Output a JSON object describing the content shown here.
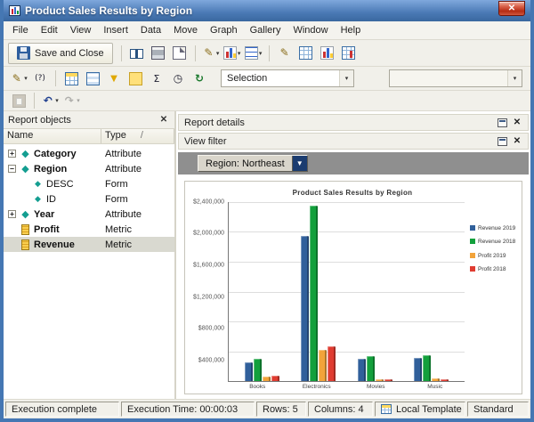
{
  "window": {
    "title": "Product Sales Results by Region"
  },
  "menu_bar": {
    "items": [
      "File",
      "Edit",
      "View",
      "Insert",
      "Data",
      "Move",
      "Graph",
      "Gallery",
      "Window",
      "Help"
    ]
  },
  "icons": {
    "close": "✕",
    "dropdown_arrow": "▼",
    "dropdown_small": "▾",
    "undo": "↶",
    "redo": "↷",
    "clock": "◷",
    "sigma": "Σ",
    "autotext": "(?)",
    "refresh": "↻",
    "pencil": "✎",
    "funnel": "▼",
    "diamond": "◆",
    "expand": "+",
    "collapse": "−"
  },
  "toolbars": {
    "save_and_close_label": "Save and Close",
    "selection_combo_value": "Selection",
    "secondary_combo_value": "",
    "row1_icon_groups": [
      [
        "book",
        "printer",
        "page-setup"
      ],
      [
        "format-painter-dd",
        "graph-format-dd",
        "autostyle-dd"
      ],
      [
        "design-view",
        "grid-view",
        "graph-view",
        "grid-graph-view"
      ]
    ],
    "row2_icon_groups": [
      [
        "format-brush-dd",
        "autotext"
      ],
      [
        "grid-color",
        "banding",
        "view-filter",
        "note",
        "totals",
        "clock",
        "refresh"
      ]
    ],
    "row3_icon_groups": [
      [
        "paste"
      ],
      [
        "undo-dd",
        "redo-dd"
      ]
    ],
    "disabled_icons": [
      "paste",
      "redo-dd"
    ]
  },
  "report_objects": {
    "title": "Report objects",
    "columns": [
      "Name",
      "Type"
    ],
    "type_header_suffix": "/",
    "rows": [
      {
        "name": "Category",
        "type": "Attribute",
        "level": 0,
        "expander": "+",
        "icon": "attribute",
        "selected": false
      },
      {
        "name": "Region",
        "type": "Attribute",
        "level": 0,
        "expander": "-",
        "icon": "attribute",
        "selected": false
      },
      {
        "name": "DESC",
        "type": "Form",
        "level": 1,
        "expander": "",
        "icon": "form",
        "selected": false
      },
      {
        "name": "ID",
        "type": "Form",
        "level": 1,
        "expander": "",
        "icon": "form",
        "selected": false
      },
      {
        "name": "Year",
        "type": "Attribute",
        "level": 0,
        "expander": "+",
        "icon": "attribute",
        "selected": false
      },
      {
        "name": "Profit",
        "type": "Metric",
        "level": 0,
        "expander": "",
        "icon": "metric",
        "selected": false
      },
      {
        "name": "Revenue",
        "type": "Metric",
        "level": 0,
        "expander": "",
        "icon": "metric",
        "selected": true
      }
    ]
  },
  "panels": {
    "report_details": "Report details",
    "view_filter": "View filter"
  },
  "view_filter": {
    "region_dropdown": "Region: Northeast"
  },
  "chart_data": {
    "type": "bar",
    "title": "Product Sales Results by Region",
    "categories": [
      "Books",
      "Electronics",
      "Movies",
      "Music"
    ],
    "series": [
      {
        "name": "Revenue 2019",
        "color": "#31609b",
        "values": [
          250000,
          1950000,
          300000,
          310000
        ]
      },
      {
        "name": "Revenue 2018",
        "color": "#13a03c",
        "values": [
          300000,
          2350000,
          330000,
          350000
        ]
      },
      {
        "name": "Profit 2019",
        "color": "#f2a33a",
        "values": [
          60000,
          420000,
          30000,
          40000
        ]
      },
      {
        "name": "Profit 2018",
        "color": "#e03c31",
        "values": [
          70000,
          460000,
          30000,
          30000
        ]
      }
    ],
    "ylim": [
      0,
      2400000
    ],
    "yticks": [
      "$2,400,000",
      "$2,000,000",
      "$1,600,000",
      "$1,200,000",
      "$800,000",
      "$400,000"
    ],
    "ytick_step": 400000,
    "legend_position": "right",
    "grid": true
  },
  "status_bar": {
    "segments": [
      {
        "text": "Execution complete"
      },
      {
        "text": "Execution Time: 00:00:03"
      },
      {
        "text": "Rows: 5"
      },
      {
        "text": "Columns: 4"
      },
      {
        "text": "Local Template",
        "icon": "local-template-grid"
      },
      {
        "text": "Standard"
      }
    ]
  }
}
